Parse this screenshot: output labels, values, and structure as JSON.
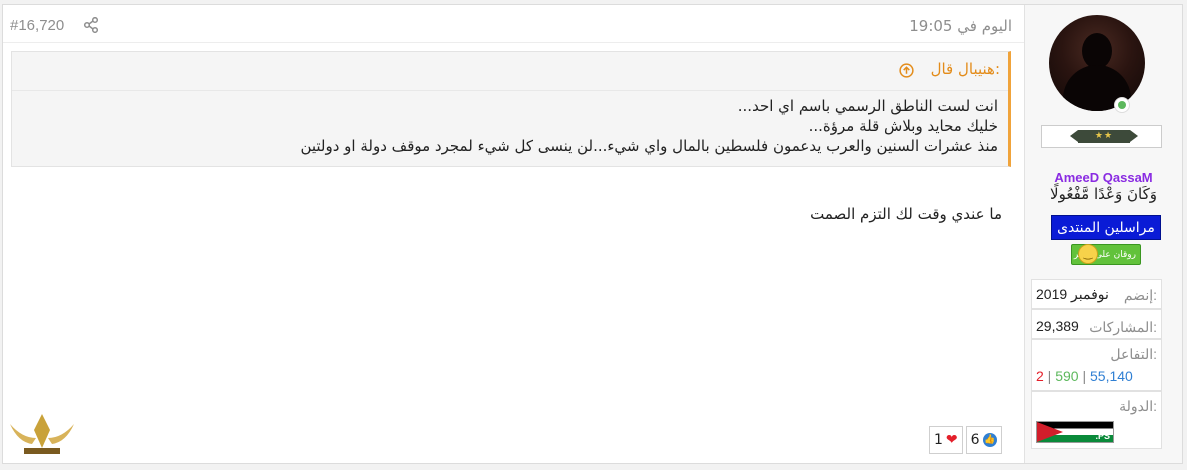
{
  "post": {
    "number": "#16,720",
    "date": "اليوم في 19:05",
    "quote": {
      "author_line": "هنيبال قال:",
      "lines": [
        "انت لست الناطق الرسمي باسم اي احد...",
        "خليك محايد وبلاش قلة مرؤة...",
        "منذ عشرات السنين والعرب يدعمون فلسطين بالمال واي شيء...لن ينسى كل شيء لمجرد موقف دولة او دولتين"
      ]
    },
    "message": "ما عندي وقت لك التزم الصمت",
    "reactions": {
      "like_count": "6",
      "love_count": "1"
    }
  },
  "user": {
    "rank_stars": "★★",
    "username": "AmeeD QassaM",
    "title": "وَكَانَ وَعْدًا مَّفْعُولًا",
    "banner": "مراسلين المنتدى",
    "mood": "روقان على الاخر",
    "joined_label": "إنضم:",
    "joined_value": "نوفمبر 2019",
    "posts_label": "المشاركات:",
    "posts_value": "29,389",
    "reactions_label": "التفاعل:",
    "reactions_blue": "55,140",
    "reactions_green": "590",
    "reactions_red": "2",
    "country_label": "الدولة:",
    "flag_code": ".PS"
  },
  "colors": {
    "accent_orange": "#e38c1a",
    "username_purple": "#8a2be2",
    "banner_blue": "#0a1bd6",
    "stat_blue": "#2f7fd3",
    "stat_green": "#5cb85c",
    "stat_red": "#e4202b"
  }
}
